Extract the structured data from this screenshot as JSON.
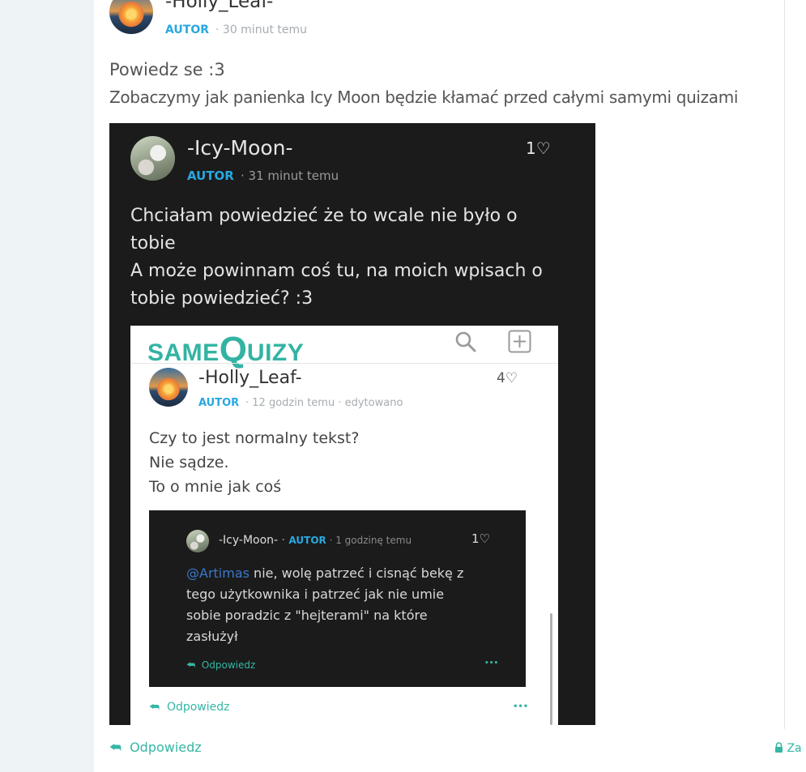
{
  "main_post": {
    "author": "-Holly_Leaf-",
    "badge": "AUTOR",
    "time": "30 minut temu",
    "lines": [
      "Powiedz se :3",
      "Zobaczymy jak panienka Icy Moon będzie kłamać przed całymi samymi quizami"
    ],
    "reply_label": "Odpowiedz",
    "lock_label": "Za"
  },
  "screenshot": {
    "author": "-Icy-Moon-",
    "badge": "AUTOR",
    "time": "31 minut temu",
    "likes": "1",
    "lines": [
      "Chciałam powiedzieć że to wcale nie było o",
      "tobie",
      "A może powinnam coś tu, na moich wpisach o",
      "tobie powiedzieć? :3"
    ],
    "inner": {
      "logo_same": "SAME",
      "logo_q": "Q",
      "logo_uizy": "UIZY",
      "author": "-Holly_Leaf-",
      "badge": "AUTOR",
      "time": "12 godzin temu",
      "edited": "edytowano",
      "likes": "4",
      "lines": [
        "Czy to jest normalny tekst?",
        "Nie sądze.",
        "To o mnie jak coś"
      ],
      "reply_label": "Odpowiedz",
      "more": "•••",
      "nested": {
        "author": "-Icy-Moon-",
        "badge": "AUTOR",
        "time": "1 godzinę temu",
        "likes": "1",
        "mention": "@Artimas",
        "line1_rest": " nie, wolę patrzeć i cisnąć bekę z",
        "lines": [
          "tego użytkownika i patrzeć jak nie umie",
          "sobie poradzic z \"hejterami\" na które",
          "zasłużył"
        ],
        "reply_label": "Odpowiedz",
        "more": "•••"
      }
    }
  },
  "colors": {
    "accent": "#29a8e0",
    "teal": "#35b7a5",
    "dark": "#1b1b1b"
  }
}
